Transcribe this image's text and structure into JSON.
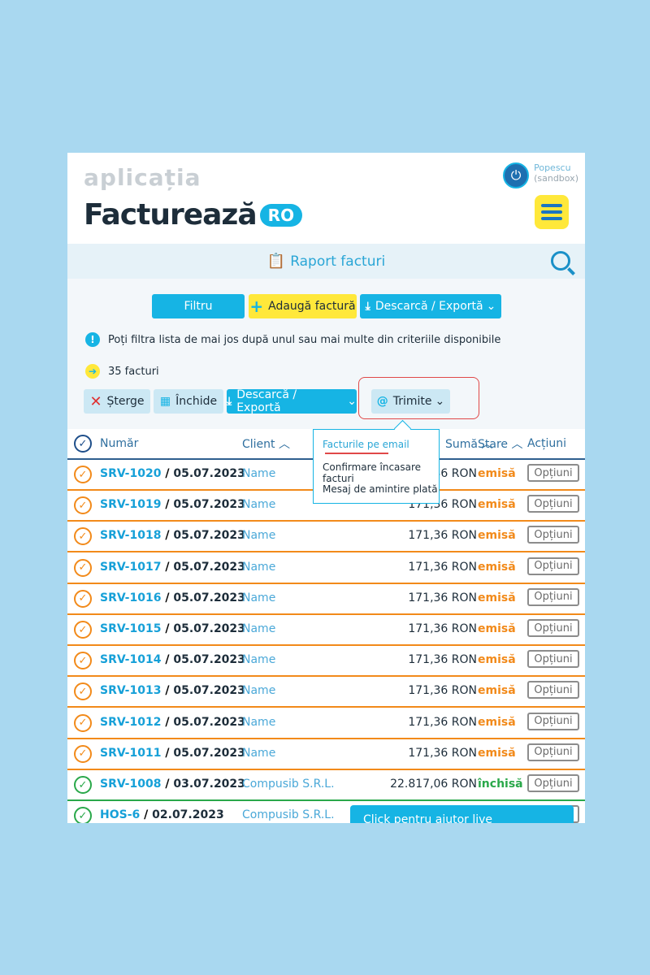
{
  "header": {
    "logo_top": "aplicația",
    "logo_main": "Facturează",
    "logo_suffix": "RO",
    "user_name": "Popescu",
    "user_env": "(sandbox)"
  },
  "titlebar": {
    "title": "Raport facturi"
  },
  "toolbar": {
    "filter_label": "Filtru",
    "add_label": "Adaugă factură",
    "export_label": "Descarcă / Exportă"
  },
  "info": {
    "text": "Poți filtra lista de mai jos după unul sau mai multe din criteriile disponibile"
  },
  "count": {
    "text": "35 facturi"
  },
  "actions": {
    "delete_label": "Șterge",
    "close_label": "Închide",
    "export_label": "Descarcă / Exportă",
    "send_label": "Trimite"
  },
  "dropdown": {
    "items": [
      "Facturile pe email",
      "Confirmare încasare facturi",
      "Mesaj de amintire plată"
    ]
  },
  "table": {
    "headers": {
      "number": "Număr",
      "client": "Client",
      "amount": "Sumă",
      "status": "Stare",
      "actions": "Acțiuni"
    },
    "option_label": "Opțiuni",
    "rows": [
      {
        "code": "SRV-1020",
        "date": "05.07.2023",
        "client": "Name",
        "amount": "171,36 RON",
        "status": "emisă",
        "state": "issued"
      },
      {
        "code": "SRV-1019",
        "date": "05.07.2023",
        "client": "Name",
        "amount": "171,36 RON",
        "status": "emisă",
        "state": "issued"
      },
      {
        "code": "SRV-1018",
        "date": "05.07.2023",
        "client": "Name",
        "amount": "171,36 RON",
        "status": "emisă",
        "state": "issued"
      },
      {
        "code": "SRV-1017",
        "date": "05.07.2023",
        "client": "Name",
        "amount": "171,36 RON",
        "status": "emisă",
        "state": "issued"
      },
      {
        "code": "SRV-1016",
        "date": "05.07.2023",
        "client": "Name",
        "amount": "171,36 RON",
        "status": "emisă",
        "state": "issued"
      },
      {
        "code": "SRV-1015",
        "date": "05.07.2023",
        "client": "Name",
        "amount": "171,36 RON",
        "status": "emisă",
        "state": "issued"
      },
      {
        "code": "SRV-1014",
        "date": "05.07.2023",
        "client": "Name",
        "amount": "171,36 RON",
        "status": "emisă",
        "state": "issued"
      },
      {
        "code": "SRV-1013",
        "date": "05.07.2023",
        "client": "Name",
        "amount": "171,36 RON",
        "status": "emisă",
        "state": "issued"
      },
      {
        "code": "SRV-1012",
        "date": "05.07.2023",
        "client": "Name",
        "amount": "171,36 RON",
        "status": "emisă",
        "state": "issued"
      },
      {
        "code": "SRV-1011",
        "date": "05.07.2023",
        "client": "Name",
        "amount": "171,36 RON",
        "status": "emisă",
        "state": "issued"
      },
      {
        "code": "SRV-1008",
        "date": "03.07.2023",
        "client": "Compusib S.R.L.",
        "amount": "22.817,06 RON",
        "status": "închisă",
        "state": "closed"
      },
      {
        "code": "HOS-6",
        "date": "02.07.2023",
        "client": "Compusib S.R.L.",
        "amount": "",
        "status": "",
        "state": "closed"
      }
    ]
  },
  "chat": {
    "label": "Click pentru ajutor live"
  },
  "colors": {
    "issued": "#f28a1a",
    "closed": "#2aa84a",
    "accent": "#16b4e4",
    "yellow": "#ffe83a"
  }
}
